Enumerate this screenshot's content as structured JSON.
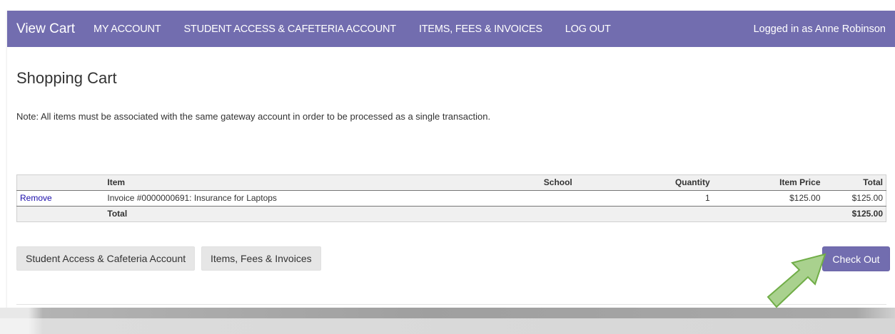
{
  "navbar": {
    "brand": "View Cart",
    "links": [
      "MY ACCOUNT",
      "STUDENT ACCESS & CAFETERIA ACCOUNT",
      "ITEMS, FEES & INVOICES",
      "LOG OUT"
    ],
    "user_status": "Logged in as Anne Robinson"
  },
  "page": {
    "title": "Shopping Cart",
    "note": "Note: All items must be associated with the same gateway account in order to be processed as a single transaction."
  },
  "cart_table": {
    "headers": {
      "item": "Item",
      "school": "School",
      "quantity": "Quantity",
      "item_price": "Item Price",
      "total": "Total"
    },
    "rows": [
      {
        "action": "Remove",
        "item": "Invoice #0000000691: Insurance for Laptops",
        "school": "",
        "quantity": "1",
        "item_price": "$125.00",
        "total": "$125.00"
      }
    ],
    "footer": {
      "label": "Total",
      "total": "$125.00"
    }
  },
  "buttons": {
    "student_access": "Student Access & Cafeteria Account",
    "items_fees": "Items, Fees & Invoices",
    "check_out": "Check Out"
  },
  "colors": {
    "accent": "#726daf",
    "arrow_fill": "#a9d18e",
    "arrow_stroke": "#70ad47"
  }
}
